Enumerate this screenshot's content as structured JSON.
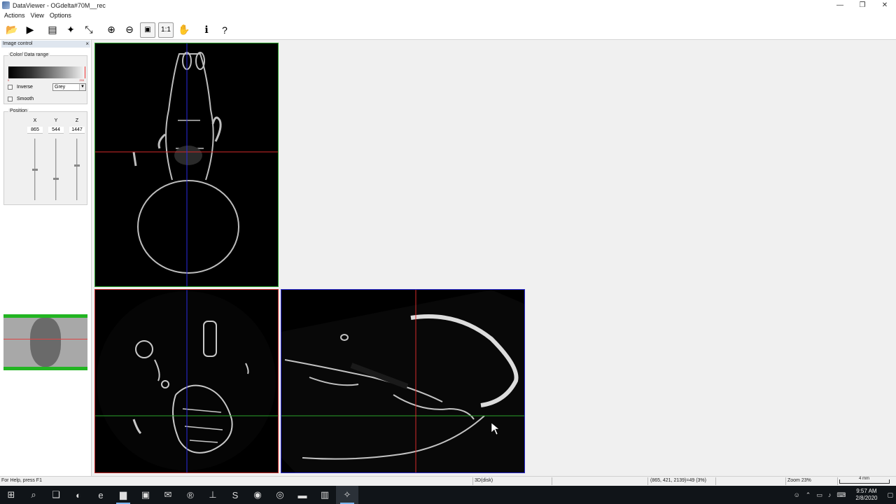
{
  "window": {
    "title": "DataViewer - OGdelta#70M__rec",
    "minimize": "—",
    "restore": "❐",
    "close": "✕"
  },
  "menu": [
    "Actions",
    "View",
    "Options"
  ],
  "toolbar": {
    "buttons": [
      {
        "name": "open-icon",
        "glyph": "📂"
      },
      {
        "name": "play-icon",
        "glyph": "▶"
      },
      {
        "name": "slices-icon",
        "glyph": "▤"
      },
      {
        "name": "render-icon",
        "glyph": "✦"
      },
      {
        "name": "axes-3d-icon",
        "glyph": "⤡"
      },
      {
        "name": "zoom-in-icon",
        "glyph": "⊕"
      },
      {
        "name": "zoom-out-icon",
        "glyph": "⊖"
      },
      {
        "name": "fit-icon",
        "glyph": "▣"
      },
      {
        "name": "one-to-one-icon",
        "glyph": "1:1"
      },
      {
        "name": "pan-hand-icon",
        "glyph": "✋"
      },
      {
        "name": "info-icon",
        "glyph": "ℹ"
      },
      {
        "name": "help-icon",
        "glyph": "?"
      }
    ]
  },
  "panel": {
    "header": "Image control",
    "close": "×",
    "color_group": "Color/ Data range",
    "range_min": "0",
    "range_max": "255",
    "inverse_label": "Inverse",
    "smooth_label": "Smooth",
    "colormap": "Grey",
    "position_group": "Position",
    "axes": [
      {
        "label": "X",
        "value": "865",
        "slider_fraction": 0.5
      },
      {
        "label": "Y",
        "value": "544",
        "slider_fraction": 0.66
      },
      {
        "label": "Z",
        "value": "1447",
        "slider_fraction": 0.44
      }
    ]
  },
  "status": {
    "help": "For Help, press F1",
    "mode": "3D(disk)",
    "coords": "(865, 421, 2139)=49 (3%)",
    "zoom": "Zoom 23%",
    "scale": "4 mm"
  },
  "taskbar": {
    "apps": [
      "start-icon",
      "search-icon",
      "task-view-icon",
      "edge-icon",
      "ie-icon",
      "explorer-icon",
      "store-icon",
      "outlook-icon",
      "app-r-icon",
      "app-plus-icon",
      "skype-icon",
      "chrome-icon",
      "app-circle-icon",
      "app-green-icon",
      "app-grid-icon",
      "dataviewer-icon"
    ],
    "time": "9:57 AM",
    "date": "2/8/2020"
  },
  "colors": {
    "crosshair_red": "#d42a2a",
    "crosshair_blue": "#2a2ae0",
    "crosshair_green": "#2aa22a"
  }
}
